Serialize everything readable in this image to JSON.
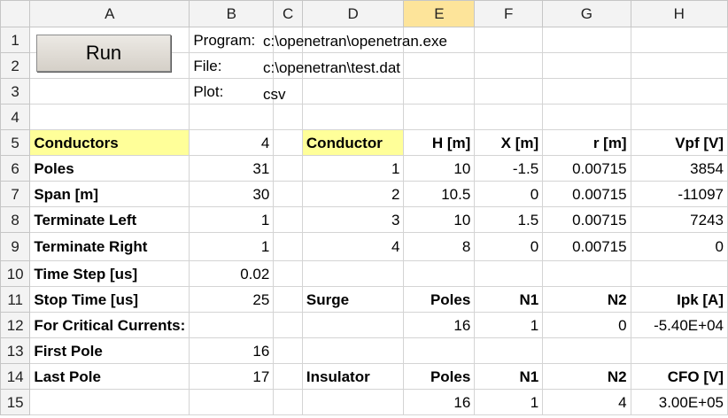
{
  "columns": [
    "A",
    "B",
    "C",
    "D",
    "E",
    "F",
    "G",
    "H"
  ],
  "rows": [
    "1",
    "2",
    "3",
    "4",
    "5",
    "6",
    "7",
    "8",
    "9",
    "10",
    "11",
    "12",
    "13",
    "14",
    "15"
  ],
  "run_button": {
    "label": "Run"
  },
  "settings": {
    "program_label": "Program:",
    "program_value": "c:\\openetran\\openetran.exe",
    "file_label": "File:",
    "file_value": "c:\\openetran\\test.dat",
    "plot_label": "Plot:",
    "plot_value": "csv"
  },
  "params": {
    "conductors_label": "Conductors",
    "conductors_value": "4",
    "poles_label": "Poles",
    "poles_value": "31",
    "span_label": "Span [m]",
    "span_value": "30",
    "terminate_left_label": "Terminate Left",
    "terminate_left_value": "1",
    "terminate_right_label": "Terminate Right",
    "terminate_right_value": "1",
    "time_step_label": "Time Step [us]",
    "time_step_value": "0.02",
    "stop_time_label": "Stop Time [us]",
    "stop_time_value": "25",
    "critical_label": "For Critical Currents:",
    "first_pole_label": "First Pole",
    "first_pole_value": "16",
    "last_pole_label": "Last Pole",
    "last_pole_value": "17"
  },
  "conductor_table": {
    "headers": [
      "Conductor",
      "H [m]",
      "X [m]",
      "r [m]",
      "Vpf [V]"
    ],
    "rows": [
      [
        "1",
        "10",
        "-1.5",
        "0.00715",
        "3854"
      ],
      [
        "2",
        "10.5",
        "0",
        "0.00715",
        "-11097"
      ],
      [
        "3",
        "10",
        "1.5",
        "0.00715",
        "7243"
      ],
      [
        "4",
        "8",
        "0",
        "0.00715",
        "0"
      ]
    ]
  },
  "surge_table": {
    "headers": [
      "Surge",
      "Poles",
      "N1",
      "N2",
      "Ipk [A]"
    ],
    "row": [
      "16",
      "1",
      "0",
      "-5.40E+04"
    ]
  },
  "insulator_table": {
    "headers": [
      "Insulator",
      "Poles",
      "N1",
      "N2",
      "CFO [V]"
    ],
    "row": [
      "16",
      "1",
      "4",
      "3.00E+05"
    ]
  },
  "colors": {
    "highlight": "#ffff99",
    "selected_column_header": "#fde49a"
  }
}
